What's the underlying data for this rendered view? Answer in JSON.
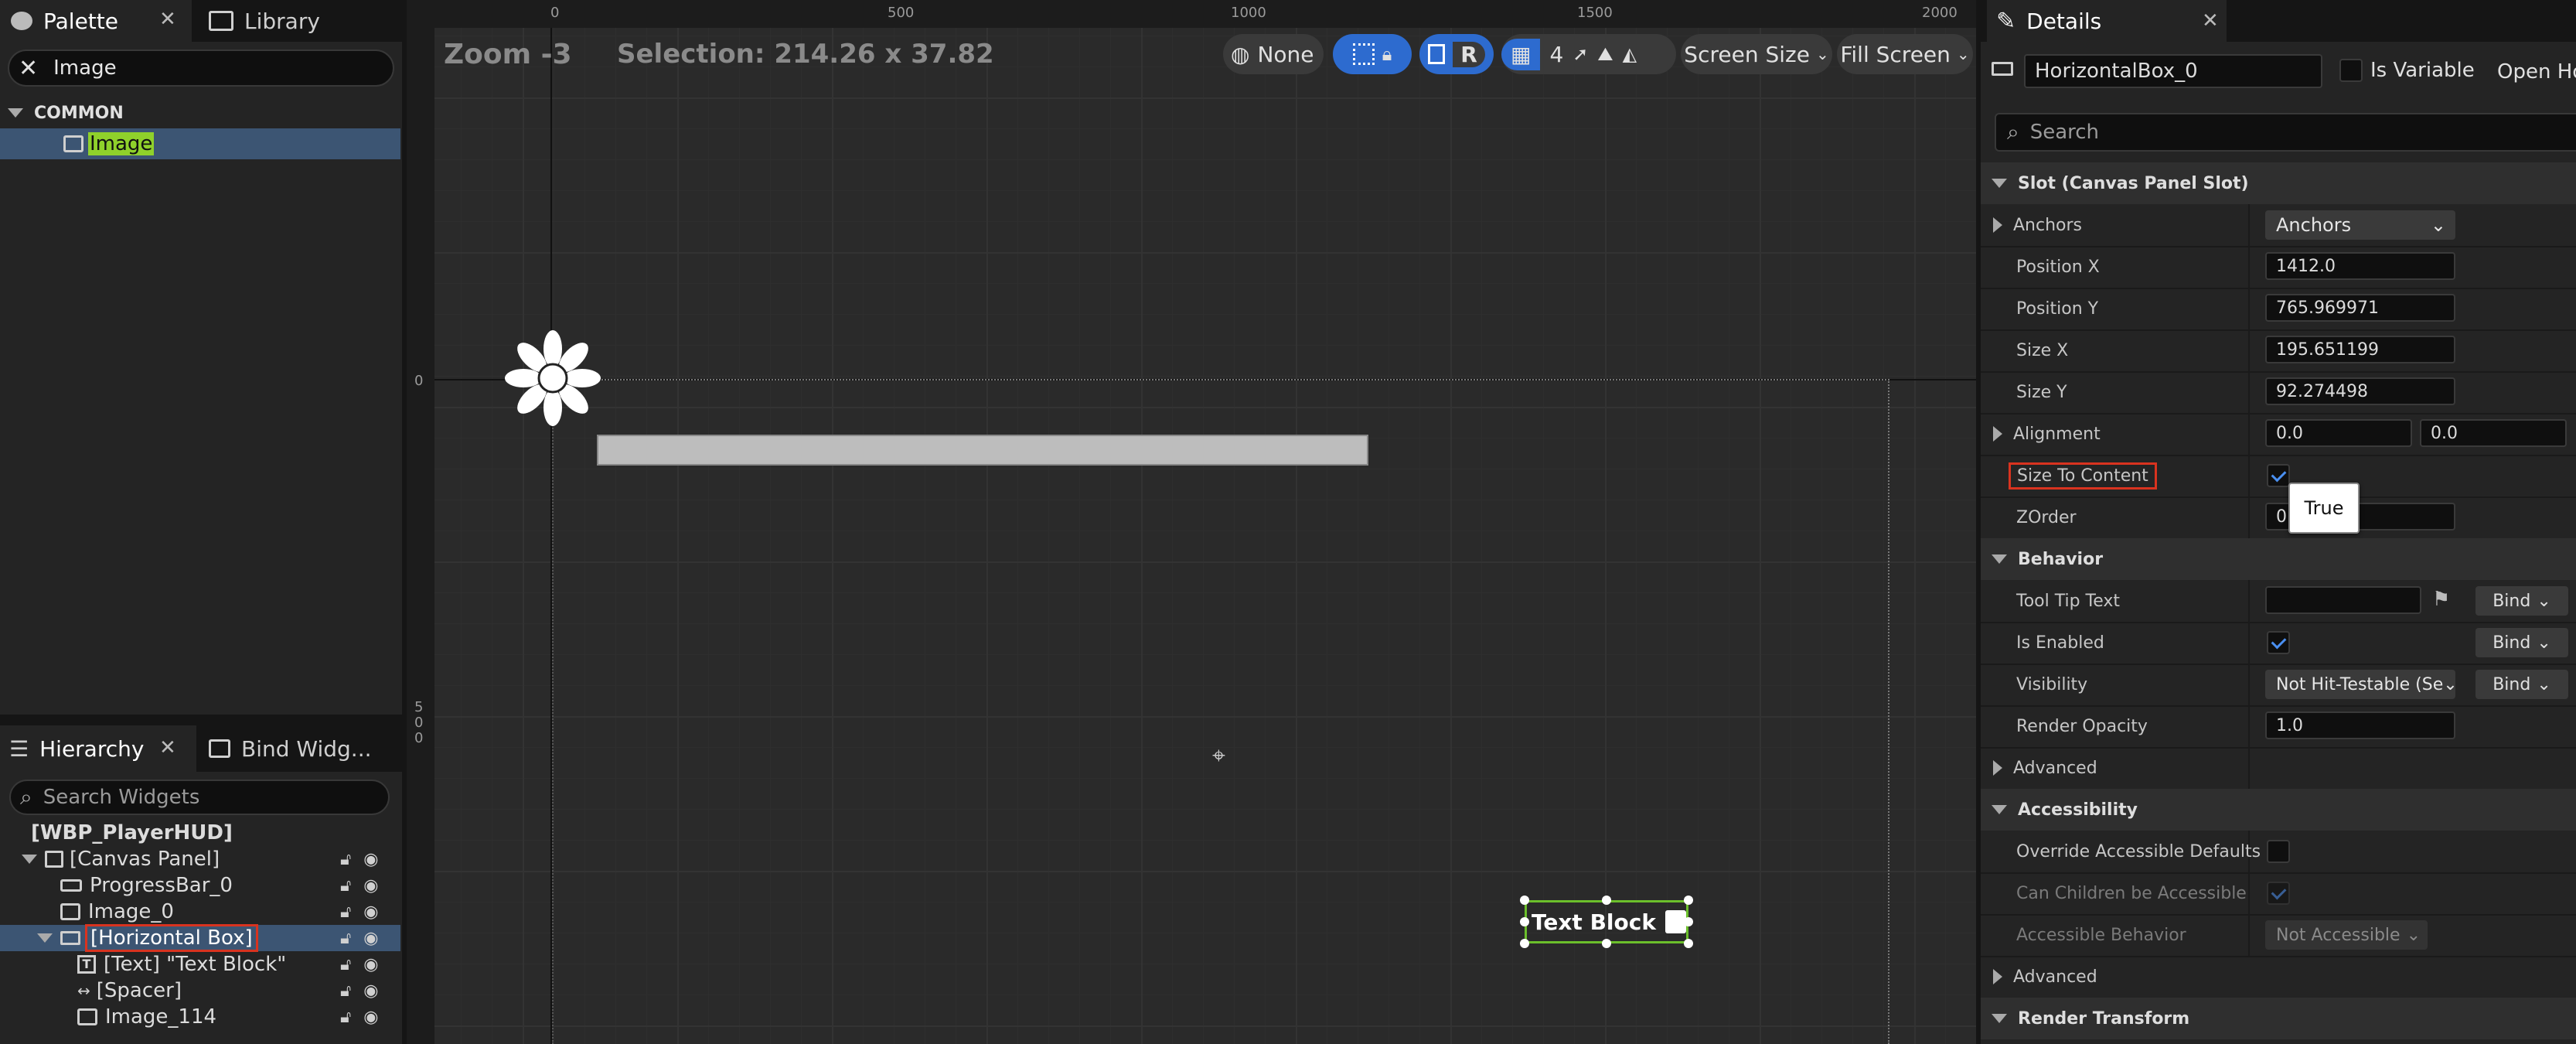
{
  "palette": {
    "tab_palette": "Palette",
    "tab_library": "Library",
    "search_value": "Image",
    "category": "COMMON",
    "item": "Image"
  },
  "hierarchy": {
    "tab_hierarchy": "Hierarchy",
    "tab_bind": "Bind Widg...",
    "search_placeholder": "Search Widgets",
    "root": "[WBP_PlayerHUD]",
    "canvas": "[Canvas Panel]",
    "progress": "ProgressBar_0",
    "image0": "Image_0",
    "hbox": "[Horizontal Box]",
    "text": "[Text] \"Text Block\"",
    "spacer": "[Spacer]",
    "image114": "Image_114"
  },
  "canvas": {
    "zoom": "Zoom -3",
    "selection": "Selection: 214.26 x 37.82",
    "none_label": "None",
    "r_label": "R",
    "grid_num": "4",
    "screen_size": "Screen Size",
    "fill_screen": "Fill Screen",
    "ruler_top": [
      "0",
      "500",
      "1000",
      "1500",
      "2000"
    ],
    "ruler_left": [
      "0",
      "0",
      "5",
      "0",
      "0"
    ],
    "text_block": "Text Block"
  },
  "details": {
    "tab": "Details",
    "name": "HorizontalBox_0",
    "is_variable": "Is Variable",
    "open": "Open Ho",
    "search_placeholder": "Search",
    "slot_section": "Slot (Canvas Panel Slot)",
    "anchors_label": "Anchors",
    "anchors_value": "Anchors",
    "posx_label": "Position X",
    "posx_value": "1412.0",
    "posy_label": "Position Y",
    "posy_value": "765.969971",
    "sizex_label": "Size X",
    "sizex_value": "195.651199",
    "sizey_label": "Size Y",
    "sizey_value": "92.274498",
    "alignment_label": "Alignment",
    "align_x": "0.0",
    "align_y": "0.0",
    "size_to_content": "Size To Content",
    "tooltip_true": "True",
    "zorder_label": "ZOrder",
    "zorder_value": "0",
    "behavior": "Behavior",
    "tooltip_text": "Tool Tip Text",
    "bind": "Bind",
    "is_enabled": "Is Enabled",
    "visibility": "Visibility",
    "visibility_value": "Not Hit-Testable (Se",
    "render_opacity": "Render Opacity",
    "render_opacity_value": "1.0",
    "advanced": "Advanced",
    "accessibility": "Accessibility",
    "override_acc": "Override Accessible Defaults",
    "can_children": "Can Children be Accessible",
    "acc_behavior": "Accessible Behavior",
    "acc_behavior_value": "Not Accessible",
    "advanced2": "Advanced",
    "render_transform": "Render Transform"
  },
  "colors": {
    "accent_blue": "#2d6bcf",
    "highlight_green": "#8fd12b",
    "red_outline": "#d9331f",
    "selection_green": "#6bbf2b"
  }
}
